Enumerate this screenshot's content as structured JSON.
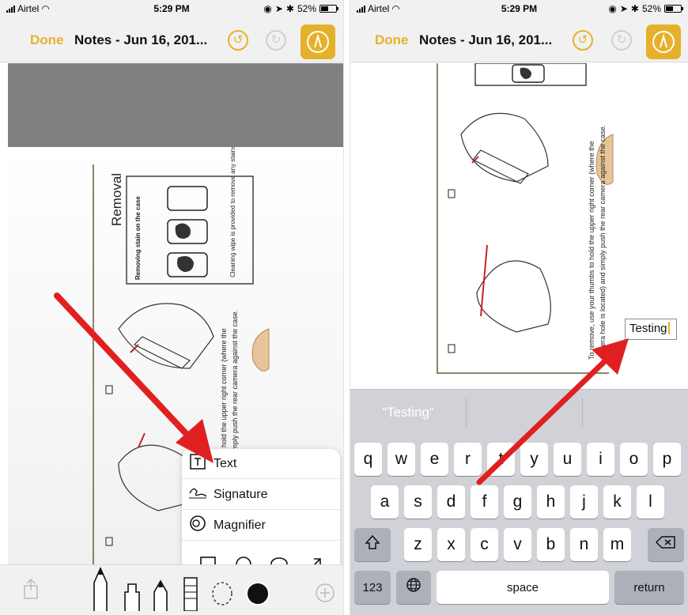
{
  "statusbar": {
    "carrier": "Airtel",
    "time": "5:29 PM",
    "battery": "52%",
    "battery_level": 0.52
  },
  "navbar": {
    "done": "Done",
    "title": "Notes - Jun 16, 201..."
  },
  "document": {
    "heading": "Removal",
    "caption_title": "Removing stain on the case",
    "caption_body": "Cleaning wipe is provided to remove any stains.",
    "instruction_line1": "To remove, use your thumbs to hold the upper right corner (where the",
    "instruction_line2": "camera hole is located) and simply push the rear camera against the case.",
    "left_line1": "to hold the upper right corner (where the",
    "left_line2": "simply push the rear camera against the case."
  },
  "popup": {
    "items": [
      {
        "label": "Text",
        "icon": "text-box-icon"
      },
      {
        "label": "Signature",
        "icon": "signature-icon"
      },
      {
        "label": "Magnifier",
        "icon": "magnifier-icon"
      }
    ],
    "shapes": [
      "square-icon",
      "circle-icon",
      "speech-bubble-icon",
      "arrow-icon"
    ]
  },
  "toolbar": {
    "tools": [
      "share-icon",
      "pen-icon",
      "marker-icon",
      "pencil-icon",
      "eraser-icon",
      "lasso-icon",
      "color-black-icon",
      "add-icon"
    ]
  },
  "text_annotation": {
    "value": "Testing"
  },
  "keyboard": {
    "suggestion": "“Testing”",
    "row1": [
      "q",
      "w",
      "e",
      "r",
      "t",
      "y",
      "u",
      "i",
      "o",
      "p"
    ],
    "row2": [
      "a",
      "s",
      "d",
      "f",
      "g",
      "h",
      "j",
      "k",
      "l"
    ],
    "row3": [
      "z",
      "x",
      "c",
      "v",
      "b",
      "n",
      "m"
    ],
    "numbers_key": "123",
    "space_key": "space",
    "return_key": "return"
  },
  "colors": {
    "accent": "#e6b12a",
    "arrow": "#e02020",
    "keyboard_bg": "#d0d2d7"
  }
}
